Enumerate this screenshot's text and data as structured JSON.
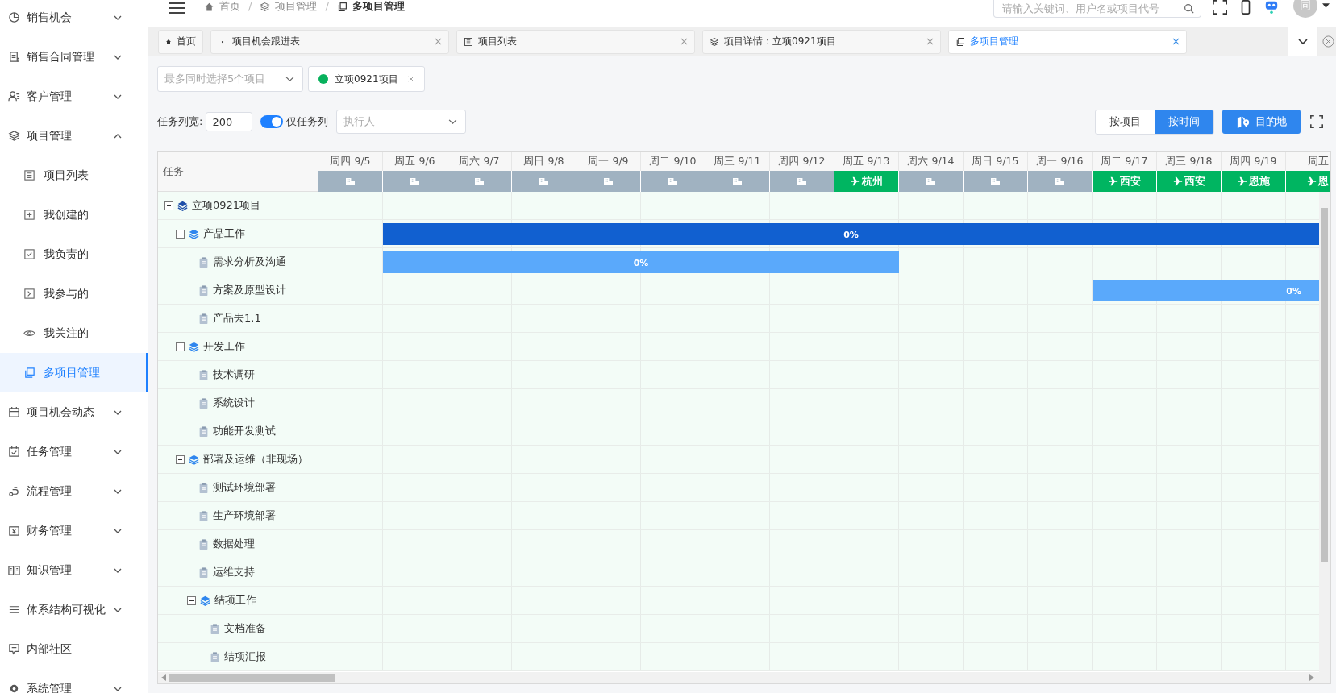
{
  "sidebar": {
    "items": [
      {
        "label": "销售机会",
        "expanded": false,
        "selected": false
      },
      {
        "label": "销售合同管理",
        "expanded": false,
        "selected": false
      },
      {
        "label": "客户管理",
        "expanded": false,
        "selected": false
      },
      {
        "label": "项目管理",
        "expanded": true,
        "selected": false,
        "children": [
          {
            "label": "项目列表",
            "selected": false
          },
          {
            "label": "我创建的",
            "selected": false
          },
          {
            "label": "我负责的",
            "selected": false
          },
          {
            "label": "我参与的",
            "selected": false
          },
          {
            "label": "我关注的",
            "selected": false
          },
          {
            "label": "多项目管理",
            "selected": true
          }
        ]
      },
      {
        "label": "项目机会动态",
        "expanded": false,
        "selected": false
      },
      {
        "label": "任务管理",
        "expanded": false,
        "selected": false
      },
      {
        "label": "流程管理",
        "expanded": false,
        "selected": false
      },
      {
        "label": "财务管理",
        "expanded": false,
        "selected": false
      },
      {
        "label": "知识管理",
        "expanded": false,
        "selected": false
      },
      {
        "label": "体系结构可视化",
        "expanded": false,
        "selected": false
      },
      {
        "label": "内部社区",
        "selected": false
      },
      {
        "label": "系统管理",
        "expanded": false,
        "selected": false
      }
    ]
  },
  "header": {
    "breadcrumbs": [
      "首页",
      "项目管理",
      "多项目管理"
    ],
    "separator": "/",
    "search": {
      "placeholder": "请输入关键词、用户名或项目代号"
    },
    "avatar": "同"
  },
  "tabs": [
    {
      "label": "首页",
      "selected": false,
      "closable": false
    },
    {
      "label": "项目机会跟进表",
      "selected": false,
      "closable": true
    },
    {
      "label": "项目列表",
      "selected": false,
      "closable": true
    },
    {
      "label": "项目详情：立项0921项目",
      "selected": false,
      "closable": true
    },
    {
      "label": "多项目管理",
      "selected": true,
      "closable": true
    }
  ],
  "project_select": {
    "placeholder": "最多同时选择5个项目",
    "chips": [
      {
        "label": "立项0921项目",
        "color": "#07b15c"
      }
    ]
  },
  "toolbar": {
    "width_label": "任务列宽:",
    "width_value": "200",
    "task_only": {
      "label": "仅任务列",
      "on": true
    },
    "assignee": {
      "placeholder": "执行人"
    },
    "modes": [
      {
        "label": "按项目",
        "selected": false
      },
      {
        "label": "按时间",
        "selected": true
      }
    ],
    "destination_button": "目的地"
  },
  "gantt": {
    "task_header": "任务",
    "days": [
      {
        "label": "周四 9/5",
        "kind": "office"
      },
      {
        "label": "周五 9/6",
        "kind": "office"
      },
      {
        "label": "周六 9/7",
        "kind": "office"
      },
      {
        "label": "周日 9/8",
        "kind": "office"
      },
      {
        "label": "周一 9/9",
        "kind": "office"
      },
      {
        "label": "周二 9/10",
        "kind": "office"
      },
      {
        "label": "周三 9/11",
        "kind": "office"
      },
      {
        "label": "周四 9/12",
        "kind": "office"
      },
      {
        "label": "周五 9/13",
        "kind": "travel",
        "city": "杭州"
      },
      {
        "label": "周六 9/14",
        "kind": "office"
      },
      {
        "label": "周日 9/15",
        "kind": "office"
      },
      {
        "label": "周一 9/16",
        "kind": "office"
      },
      {
        "label": "周二 9/17",
        "kind": "travel",
        "city": "西安"
      },
      {
        "label": "周三 9/18",
        "kind": "travel",
        "city": "西安"
      },
      {
        "label": "周四 9/19",
        "kind": "travel",
        "city": "恩施"
      },
      {
        "label": "周五",
        "kind": "travel",
        "city": "恩"
      }
    ],
    "tasks": [
      {
        "name": "立项0921项目",
        "kind": "project",
        "expanded": true,
        "children": [
          {
            "name": "产品工作",
            "kind": "group",
            "expanded": true,
            "bar": {
              "label": "0%",
              "days": [
                false,
                true,
                true,
                true,
                true,
                true,
                true,
                true,
                true,
                true,
                true,
                true,
                true,
                true,
                true,
                true
              ]
            },
            "children": [
              {
                "name": "需求分析及沟通",
                "kind": "task",
                "bar": {
                  "label": "0%",
                  "days": [
                    false,
                    true,
                    true,
                    true,
                    true,
                    true,
                    true,
                    true,
                    true,
                    false,
                    false,
                    false,
                    false,
                    false,
                    false,
                    false
                  ]
                }
              },
              {
                "name": "方案及原型设计",
                "kind": "task",
                "bar": {
                  "label": "0%",
                  "days": [
                    false,
                    false,
                    false,
                    false,
                    false,
                    false,
                    false,
                    false,
                    false,
                    false,
                    false,
                    false,
                    true,
                    true,
                    true,
                    true
                  ]
                }
              },
              {
                "name": "产品去1.1",
                "kind": "task"
              }
            ]
          },
          {
            "name": "开发工作",
            "kind": "group",
            "expanded": true,
            "children": [
              {
                "name": "技术调研",
                "kind": "task"
              },
              {
                "name": "系统设计",
                "kind": "task"
              },
              {
                "name": "功能开发测试",
                "kind": "task"
              }
            ]
          },
          {
            "name": "部署及运维（非现场）",
            "kind": "group",
            "expanded": true,
            "children": [
              {
                "name": "测试环境部署",
                "kind": "task"
              },
              {
                "name": "生产环境部署",
                "kind": "task"
              },
              {
                "name": "数据处理",
                "kind": "task"
              },
              {
                "name": "运维支持",
                "kind": "task"
              },
              {
                "name": "结项工作",
                "kind": "group",
                "expanded": true,
                "children": [
                  {
                    "name": "文档准备",
                    "kind": "task"
                  },
                  {
                    "name": "结项汇报",
                    "kind": "task"
                  }
                ]
              }
            ]
          }
        ]
      }
    ]
  }
}
